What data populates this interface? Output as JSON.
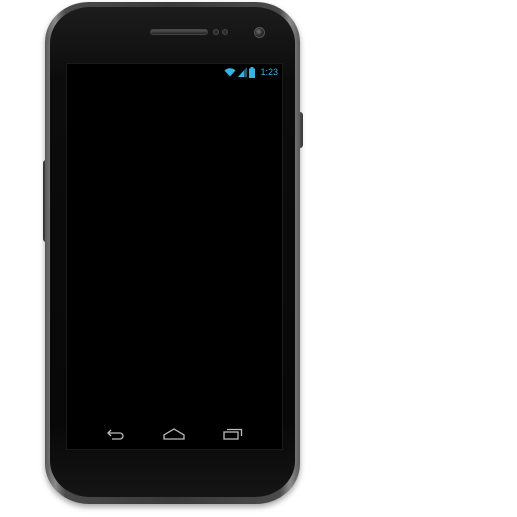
{
  "status_bar": {
    "time": "1:23",
    "icons": [
      "wifi-icon",
      "signal-icon",
      "battery-icon"
    ],
    "accent_color": "#33b5e5"
  },
  "nav_bar": {
    "buttons": [
      "back-icon",
      "home-icon",
      "recent-apps-icon"
    ],
    "icon_color": "#bdbdbd"
  },
  "device": {
    "body_color": "#3a3a3a",
    "screen_color": "#000000"
  }
}
